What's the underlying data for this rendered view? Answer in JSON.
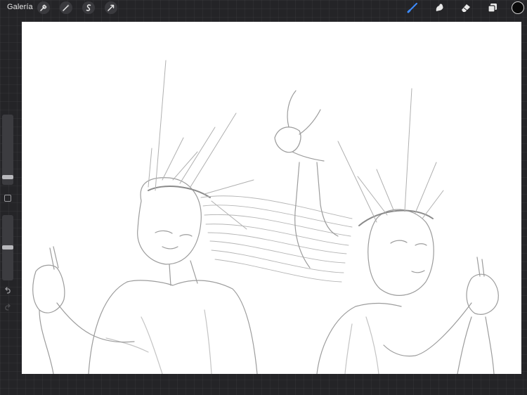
{
  "topbar": {
    "gallery_label": "Galería",
    "left_tools": [
      "wrench-icon",
      "magic-wand-icon",
      "selection-icon",
      "transform-icon"
    ],
    "right_tools": [
      "brush-icon",
      "smudge-icon",
      "eraser-icon",
      "layers-icon"
    ],
    "active_tool": "brush-icon",
    "accent_color": "#3d8bff",
    "current_color": "#0a0a0a"
  },
  "sidebar": {
    "brush_size": 0.1,
    "opacity": 0.5,
    "modify_icon": "square-icon",
    "undo_icon": "undo-icon",
    "redo_icon": "redo-icon"
  },
  "canvas": {
    "background": "#ffffff",
    "artwork_description_icon": "pencil-sketch"
  }
}
